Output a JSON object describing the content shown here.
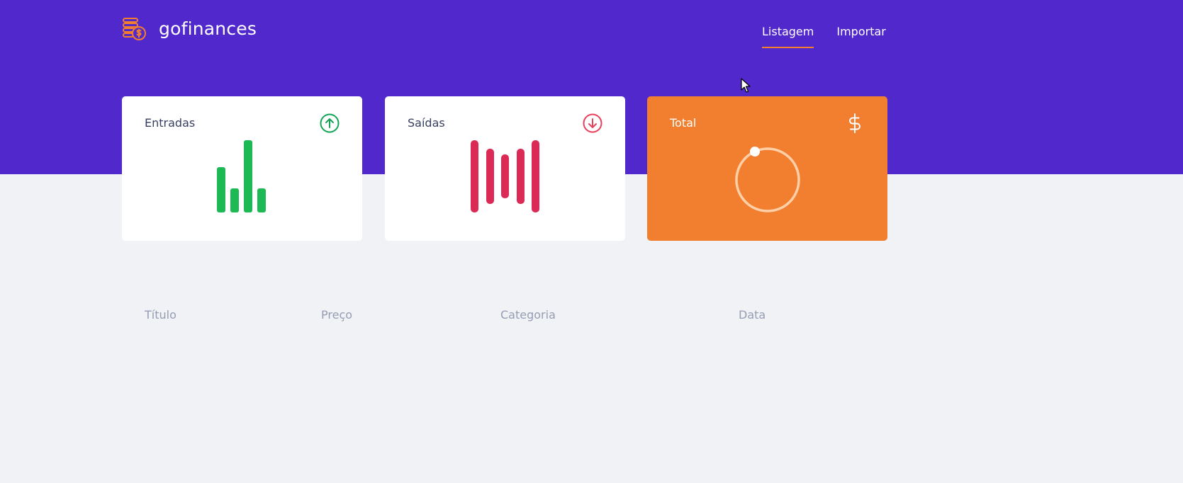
{
  "app": {
    "name": "gofinances",
    "logo_icon": "coins-dollar-icon"
  },
  "nav": {
    "items": [
      {
        "label": "Listagem",
        "active": true
      },
      {
        "label": "Importar",
        "active": false
      }
    ]
  },
  "cards": {
    "income": {
      "title": "Entradas",
      "icon": "arrow-up-circle-icon",
      "color": "#12a454"
    },
    "outcome": {
      "title": "Saídas",
      "icon": "arrow-down-circle-icon",
      "color": "#e83f5b"
    },
    "total": {
      "title": "Total",
      "icon": "dollar-sign-icon",
      "color": "#ff872c"
    }
  },
  "table": {
    "columns": [
      "Título",
      "Preço",
      "Categoria",
      "Data"
    ]
  },
  "colors": {
    "header": "#5128cc",
    "accent": "#f27e2e",
    "background": "#f0f2f5"
  }
}
